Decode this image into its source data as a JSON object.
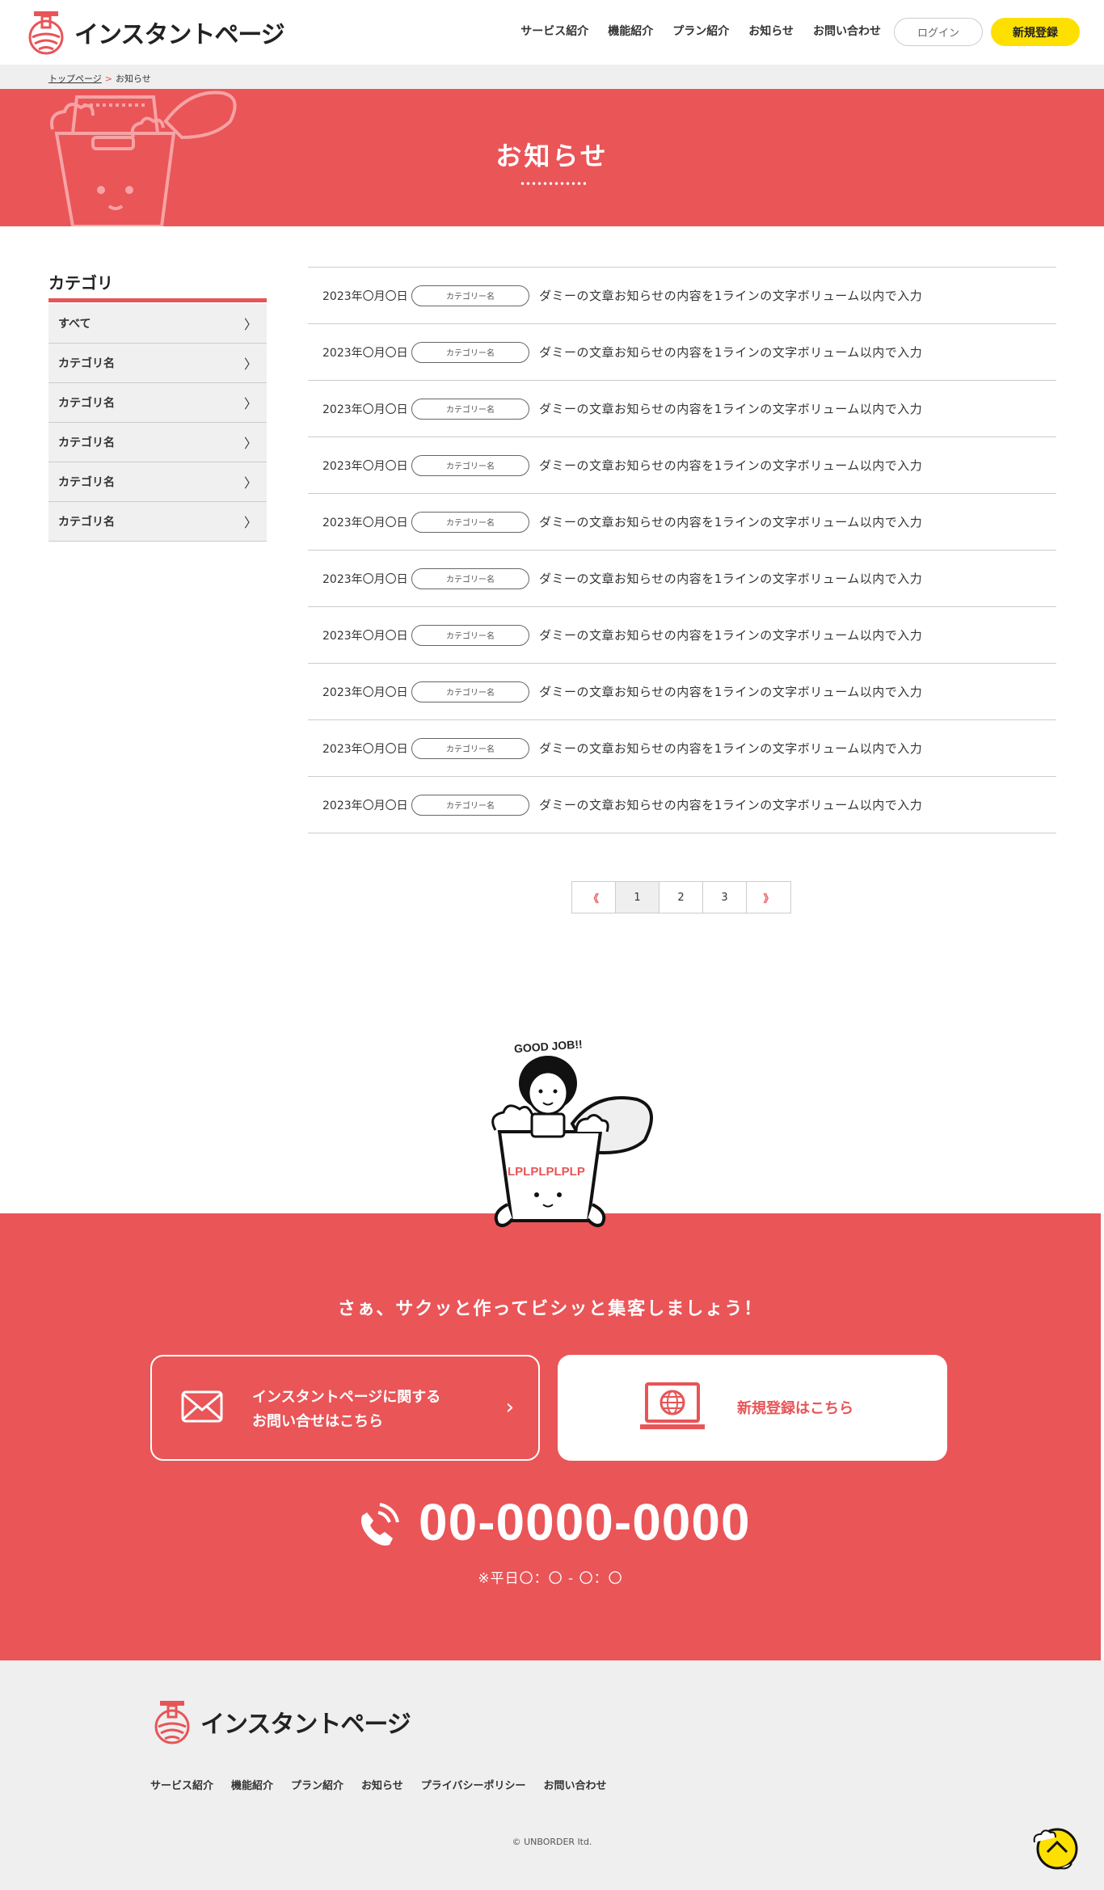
{
  "header": {
    "logo_text": "インスタントページ",
    "nav": [
      "サービス紹介",
      "機能紹介",
      "プラン紹介",
      "お知らせ",
      "お問い合わせ"
    ],
    "login_label": "ログイン",
    "register_label": "新規登録"
  },
  "breadcrumb": {
    "home": "トップページ",
    "separator": ">",
    "current": "お知らせ"
  },
  "hero": {
    "title": "お知らせ"
  },
  "sidebar": {
    "title": "カテゴリ",
    "items": [
      "すべて",
      "カテゴリ名",
      "カテゴリ名",
      "カテゴリ名",
      "カテゴリ名",
      "カテゴリ名"
    ]
  },
  "news": {
    "rows": [
      {
        "date": "2023年〇月〇日",
        "category": "カテゴリー名",
        "text": "ダミーの文章お知らせの内容を1ラインの文字ボリューム以内で入力"
      },
      {
        "date": "2023年〇月〇日",
        "category": "カテゴリー名",
        "text": "ダミーの文章お知らせの内容を1ラインの文字ボリューム以内で入力"
      },
      {
        "date": "2023年〇月〇日",
        "category": "カテゴリー名",
        "text": "ダミーの文章お知らせの内容を1ラインの文字ボリューム以内で入力"
      },
      {
        "date": "2023年〇月〇日",
        "category": "カテゴリー名",
        "text": "ダミーの文章お知らせの内容を1ラインの文字ボリューム以内で入力"
      },
      {
        "date": "2023年〇月〇日",
        "category": "カテゴリー名",
        "text": "ダミーの文章お知らせの内容を1ラインの文字ボリューム以内で入力"
      },
      {
        "date": "2023年〇月〇日",
        "category": "カテゴリー名",
        "text": "ダミーの文章お知らせの内容を1ラインの文字ボリューム以内で入力"
      },
      {
        "date": "2023年〇月〇日",
        "category": "カテゴリー名",
        "text": "ダミーの文章お知らせの内容を1ラインの文字ボリューム以内で入力"
      },
      {
        "date": "2023年〇月〇日",
        "category": "カテゴリー名",
        "text": "ダミーの文章お知らせの内容を1ラインの文字ボリューム以内で入力"
      },
      {
        "date": "2023年〇月〇日",
        "category": "カテゴリー名",
        "text": "ダミーの文章お知らせの内容を1ラインの文字ボリューム以内で入力"
      },
      {
        "date": "2023年〇月〇日",
        "category": "カテゴリー名",
        "text": "ダミーの文章お知らせの内容を1ラインの文字ボリューム以内で入力"
      }
    ]
  },
  "pagination": {
    "prev": "《",
    "pages": [
      "1",
      "2",
      "3"
    ],
    "current": "1",
    "next": "》"
  },
  "character": {
    "speech": "GOOD JOB!!",
    "cup_text": "LPLPLPLPLP"
  },
  "cta": {
    "heading": "さぁ、サクッと作ってビシッと集客しましょう！",
    "contact_line1": "インスタントページに関する",
    "contact_line2": "お問い合せはこちら",
    "register": "新規登録はこちら",
    "phone": "00-0000-0000",
    "hours": "※平日〇：〇 - 〇：〇"
  },
  "footer": {
    "logo_text": "インスタントページ",
    "nav": [
      "サービス紹介",
      "機能紹介",
      "プラン紹介",
      "お知らせ",
      "プライバシーポリシー",
      "お問い合わせ"
    ],
    "copyright": "© UNBORDER ltd."
  },
  "colors": {
    "brand_red": "#ea5558",
    "accent_yellow": "#fde000",
    "light_gray": "#efefef"
  }
}
